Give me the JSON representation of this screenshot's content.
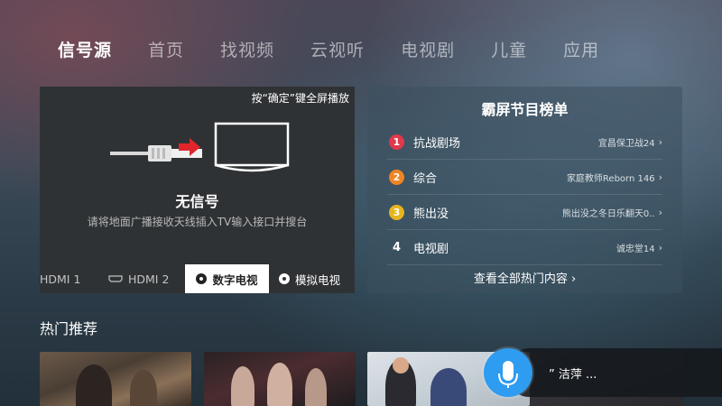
{
  "tabs": [
    {
      "label": "信号源",
      "active": true
    },
    {
      "label": "首页"
    },
    {
      "label": "找视频"
    },
    {
      "label": "云视听"
    },
    {
      "label": "电视剧"
    },
    {
      "label": "儿童"
    },
    {
      "label": "应用"
    }
  ],
  "signal": {
    "hint": "按“确定”键全屏播放",
    "title": "无信号",
    "description": "请将地面广播接收天线插入TV输入接口并搜台",
    "inputs": [
      {
        "label": "HDMI 1"
      },
      {
        "label": "HDMI 2",
        "icon": "hdmi-icon"
      },
      {
        "label": "数字电视",
        "icon": "radio-selected-icon",
        "selected": true
      },
      {
        "label": "模拟电视",
        "icon": "radio-icon"
      }
    ]
  },
  "ranking": {
    "title": "霸屏节目榜单",
    "items": [
      {
        "rank": "1",
        "channel": "抗战剧场",
        "show": "宜昌保卫战24",
        "color": "#e0394b"
      },
      {
        "rank": "2",
        "channel": "综合",
        "show": "家庭教师Reborn 146",
        "color": "#ef8422"
      },
      {
        "rank": "3",
        "channel": "熊出没",
        "show": "熊出没之冬日乐翻天0..",
        "color": "#e6b41f"
      },
      {
        "rank": "4",
        "channel": "电视剧",
        "show": "诚忠堂14"
      }
    ],
    "more": "查看全部热门内容 ›"
  },
  "hot": {
    "title": "热门推荐"
  },
  "voice": {
    "text": "” 洁萍 ...",
    "icon": "microphone-icon",
    "accent": "#2e9cf0"
  }
}
